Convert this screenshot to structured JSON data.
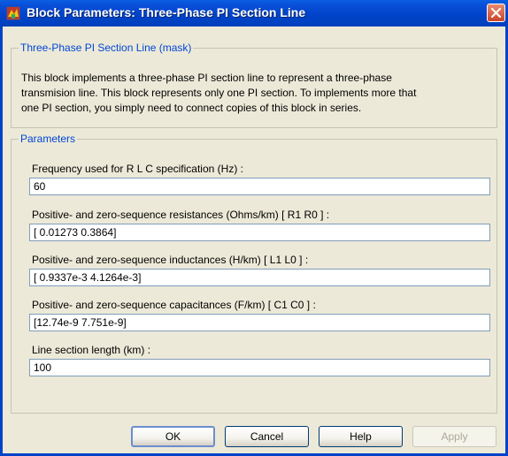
{
  "window": {
    "title": "Block Parameters: Three-Phase PI Section Line",
    "close_icon": "close-icon",
    "app_icon": "simulink-block-icon"
  },
  "mask": {
    "group_title": "Three-Phase PI Section Line (mask)",
    "description": [
      "This block implements a three-phase PI section line to represent a three-phase",
      "transmision line. This block represents only  one PI section.  To implements more that",
      "one PI section,  you  simply need to connect  copies of this block in series."
    ]
  },
  "parameters": {
    "group_title": "Parameters",
    "fields": [
      {
        "label": "Frequency used for R L C specification (Hz) :",
        "value": "60"
      },
      {
        "label": "Positive- and zero-sequence resistances (Ohms/km)  [ R1  R0 ] :",
        "value": "[ 0.01273 0.3864]"
      },
      {
        "label": "Positive- and zero-sequence inductances (H/km) [ L1  L0 ] :",
        "value": "[ 0.9337e-3  4.1264e-3]"
      },
      {
        "label": "Positive- and zero-sequence capacitances (F/km)  [ C1 C0 ] :",
        "value": "[12.74e-9 7.751e-9]"
      },
      {
        "label": "Line section length (km) :",
        "value": "100"
      }
    ]
  },
  "buttons": {
    "ok": "OK",
    "cancel": "Cancel",
    "help": "Help",
    "apply": "Apply"
  },
  "colors": {
    "titlebar": "#0043c8",
    "dialog_bg": "#ece9d8",
    "group_title": "#0046d5"
  }
}
